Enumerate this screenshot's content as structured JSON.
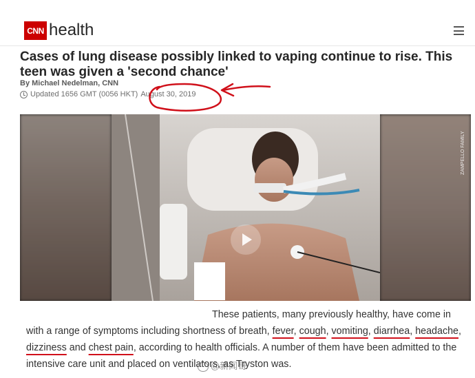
{
  "header": {
    "logo_text": "CNN",
    "section": "health",
    "menu_icon": "hamburger-menu-icon",
    "brand_color": "#cc0000"
  },
  "article": {
    "headline": "Cases of lung disease possibly linked to vaping continue to rise. This teen was given a 'second chance'",
    "byline": "By Michael Nedelman, CNN",
    "updated_prefix": "Updated 1656 GMT (0056 HKT)",
    "date": "August 30, 2019"
  },
  "media": {
    "credit": "ZAMPELLO FAMILY",
    "play_icon": "play-icon"
  },
  "body": {
    "line_start": "These patients, many previously healthy, have come in with a range of symptoms including shortness of breath,",
    "kw1": "fever",
    "sep1": ",",
    "kw2": "cough",
    "sep2": ",",
    "kw3": "vomiting",
    "sep3": ",",
    "kw4": "diarrhea",
    "sep4": ",",
    "kw5": "headache",
    "sep5": ",",
    "kw6": "dizziness",
    "sep6": "and",
    "kw7": "chest pain",
    "line_end": ", according to health officials. A number of them have been admitted to the intensive care unit and placed on ventilators, as Tryston was."
  },
  "watermark": {
    "text": "@新闻哥"
  },
  "annotation_color": "#d0101a"
}
